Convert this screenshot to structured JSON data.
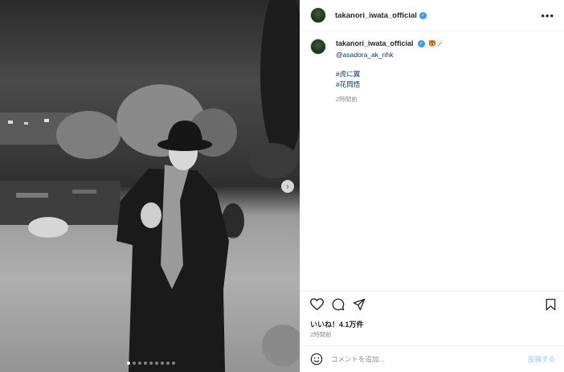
{
  "post": {
    "username": "takanori_iwata_official",
    "verified_mark": "✓",
    "more_icon": "•••",
    "caption": {
      "username": "takanori_iwata_official",
      "emoji": "🐯🪄",
      "mention": "@asadora_ak_nhk",
      "hashtag1": "#虎に翼",
      "hashtag2": "#花岡悟",
      "time": "2時間前"
    },
    "likes": "いいね！4.1万件",
    "time": "2時間前",
    "comment_placeholder": "コメントを追加...",
    "post_label": "投稿する",
    "carousel": {
      "count": 9,
      "active_index": 0,
      "next": "›"
    }
  },
  "icons": {
    "like": "heart-icon",
    "comment": "comment-icon",
    "share": "share-icon",
    "save": "bookmark-icon",
    "emoji": "emoji-icon"
  },
  "colors": {
    "link": "#00376b",
    "verified": "#3897f0",
    "post_button": "#b2dffc"
  }
}
